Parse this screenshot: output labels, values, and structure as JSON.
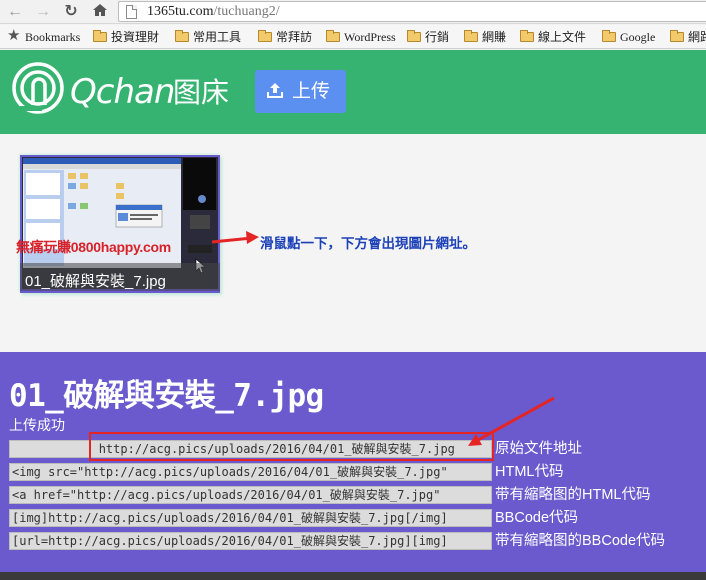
{
  "browser": {
    "url_host": "1365tu.com",
    "url_path": "/tuchuang2/",
    "nav_icons": [
      "back-arrow-icon",
      "forward-arrow-icon",
      "reload-icon",
      "home-icon"
    ],
    "bookmarks": [
      {
        "label": "Bookmarks",
        "icon": "star-icon"
      },
      {
        "label": "投資理財",
        "icon": "folder-icon"
      },
      {
        "label": "常用工具",
        "icon": "folder-icon"
      },
      {
        "label": "常拜訪",
        "icon": "folder-icon"
      },
      {
        "label": "WordPress",
        "icon": "folder-icon"
      },
      {
        "label": "行銷",
        "icon": "folder-icon"
      },
      {
        "label": "網賺",
        "icon": "folder-icon"
      },
      {
        "label": "線上文件",
        "icon": "folder-icon"
      },
      {
        "label": "Google",
        "icon": "folder-icon"
      },
      {
        "label": "網路",
        "icon": "folder-icon"
      }
    ]
  },
  "header": {
    "logo_text": "Qchan",
    "logo_cn": "图床",
    "upload_label": "上传",
    "bg_color": "#37b371",
    "button_color": "#5b8ff0"
  },
  "thumbnail": {
    "caption": "01_破解與安裝_7.jpg",
    "watermark": "無痛玩賺0800happy.com"
  },
  "hint": "滑鼠點一下，下方會出現圖片網址。",
  "result": {
    "title": "01_破解與安裝_7.jpg",
    "status": "上传成功",
    "panel_color": "#6a5acd",
    "rows": [
      {
        "code": "            http://acg.pics/uploads/2016/04/01_破解與安裝_7.jpg",
        "label": "原始文件地址"
      },
      {
        "code": "<img src=\"http://acg.pics/uploads/2016/04/01_破解與安裝_7.jpg\"",
        "label": "HTML代码"
      },
      {
        "code": "<a href=\"http://acg.pics/uploads/2016/04/01_破解與安裝_7.jpg\"",
        "label": "带有縮略图的HTML代码"
      },
      {
        "code": "[img]http://acg.pics/uploads/2016/04/01_破解與安裝_7.jpg[/img]",
        "label": "BBCode代码"
      },
      {
        "code": "[url=http://acg.pics/uploads/2016/04/01_破解與安裝_7.jpg][img]",
        "label": "带有縮略图的BBCode代码"
      }
    ]
  },
  "annotation_color": "#e52525"
}
